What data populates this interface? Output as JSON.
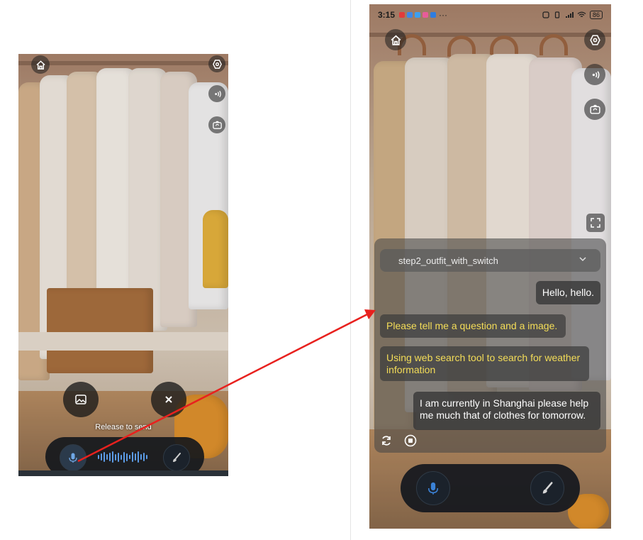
{
  "left_screen": {
    "release_text": "Release to send",
    "icons": [
      "home-icon",
      "settings-hex-icon",
      "voice-wave-icon",
      "camera-switch-icon",
      "gallery-icon",
      "close-icon",
      "mic-icon",
      "brush-icon"
    ]
  },
  "right_screen": {
    "status_bar": {
      "time": "3:15",
      "battery": "86"
    },
    "dropdown": {
      "selected": "step2_outfit_with_switch"
    },
    "messages": [
      {
        "role": "user",
        "text": "Hello, hello."
      },
      {
        "role": "bot",
        "text": "Please tell me a question and a image."
      },
      {
        "role": "bot",
        "text": "Using web search tool to search for weather information"
      },
      {
        "role": "user",
        "text": "I am currently in Shanghai please help me much that of clothes for tomorrow."
      }
    ],
    "icons": [
      "home-icon",
      "settings-hex-icon",
      "voice-wave-icon",
      "camera-switch-icon",
      "fullscreen-icon",
      "refresh-icon",
      "stop-icon",
      "mic-icon",
      "brush-icon"
    ]
  },
  "colors": {
    "bot_text": "#f4dd58",
    "annotation_arrow": "#e8211e",
    "mic_blue": "#3b82d6"
  }
}
